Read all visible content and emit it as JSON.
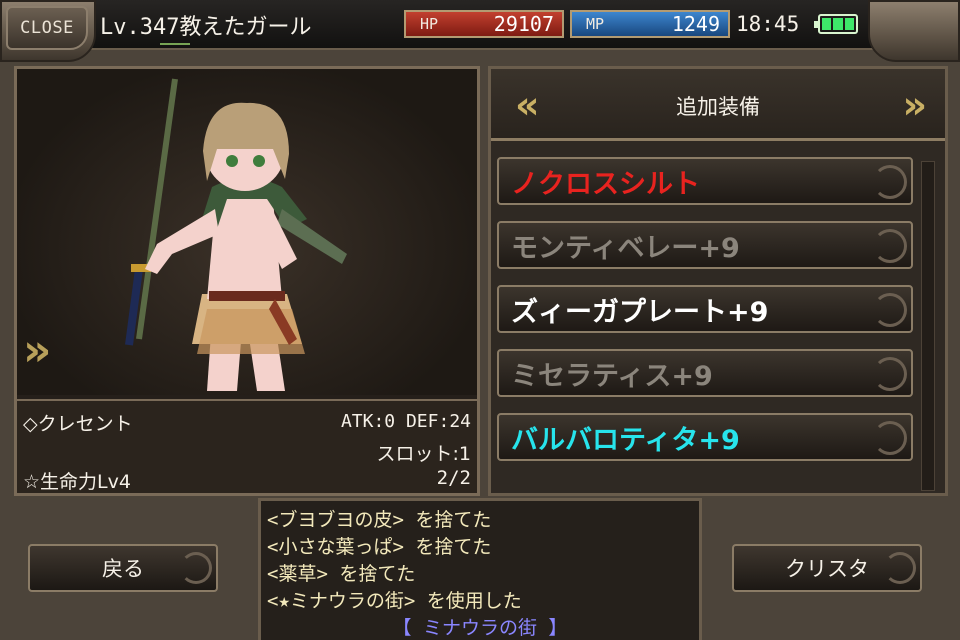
{
  "topbar": {
    "close_label": "CLOSE",
    "character_name": "Lv.347教えたガール",
    "hp_label": "HP",
    "hp_value": "29107",
    "mp_label": "MP",
    "mp_value": "1249",
    "clock": "18:45"
  },
  "character_panel": {
    "item_name": "◇クレセント",
    "atk_def": "ATK:0 DEF:24",
    "slot": "スロット:1",
    "skill": "☆生命力Lv4",
    "count": "2/2"
  },
  "equip_panel": {
    "title": "追加装備",
    "items": [
      {
        "label": "ノクロスシルト",
        "color": "#e8231f"
      },
      {
        "label": "モンティベレー+9",
        "color": "#8b857c"
      },
      {
        "label": "ズィーガプレート+9",
        "color": "#ffffff"
      },
      {
        "label": "ミセラティス+9",
        "color": "#8b857c"
      },
      {
        "label": "バルバロティタ+9",
        "color": "#27e4ec"
      }
    ]
  },
  "buttons": {
    "back_label": "戻る",
    "crysta_label": "クリスタ"
  },
  "log": {
    "lines": [
      "<ブヨブヨの皮> を捨てた",
      "<小さな葉っぱ> を捨てた",
      "<薬草> を捨てた",
      "<★ミナウラの街> を使用した",
      "【 ミナウラの街 】"
    ]
  }
}
